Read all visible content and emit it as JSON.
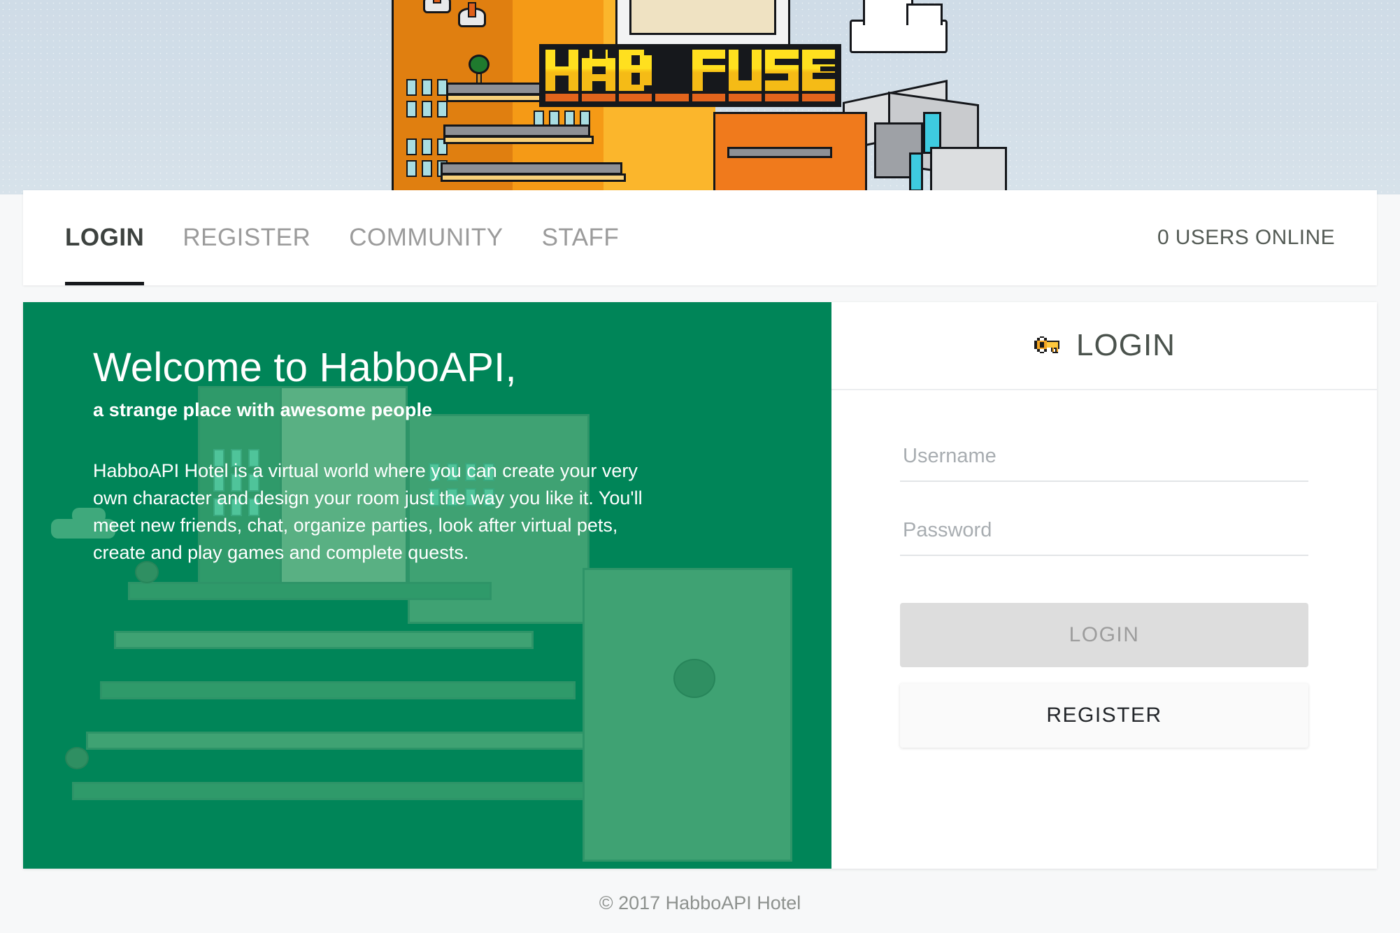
{
  "site": {
    "logo_text": "HABFUSE",
    "logo_letters": [
      "H",
      "A",
      "B",
      "",
      "F",
      "U",
      "S",
      "E"
    ]
  },
  "nav": {
    "items": [
      {
        "label": "LOGIN",
        "active": true
      },
      {
        "label": "REGISTER",
        "active": false
      },
      {
        "label": "COMMUNITY",
        "active": false
      },
      {
        "label": "STAFF",
        "active": false
      }
    ],
    "users_online": "0 USERS ONLINE"
  },
  "welcome": {
    "title": "Welcome to HabboAPI,",
    "subtitle": "a strange place with awesome people",
    "body": "HabboAPI Hotel is a virtual world where you can create your very own character and design your room just the way you like it. You'll meet new friends, chat, organize parties, look after virtual pets, create and play games and complete quests."
  },
  "login": {
    "heading": "LOGIN",
    "icon": "key-icon",
    "username_placeholder": "Username",
    "username_value": "",
    "password_placeholder": "Password",
    "password_value": "",
    "login_button": "LOGIN",
    "register_button": "REGISTER"
  },
  "footer": {
    "copyright": "© 2017 HabboAPI Hotel"
  },
  "colors": {
    "brand_green": "#008558",
    "logo_yellow": "#ffe01f",
    "logo_orange": "#e2641c",
    "logo_dark": "#16181c",
    "sky": "#d2dee8",
    "accent_key": "#f5a623"
  }
}
